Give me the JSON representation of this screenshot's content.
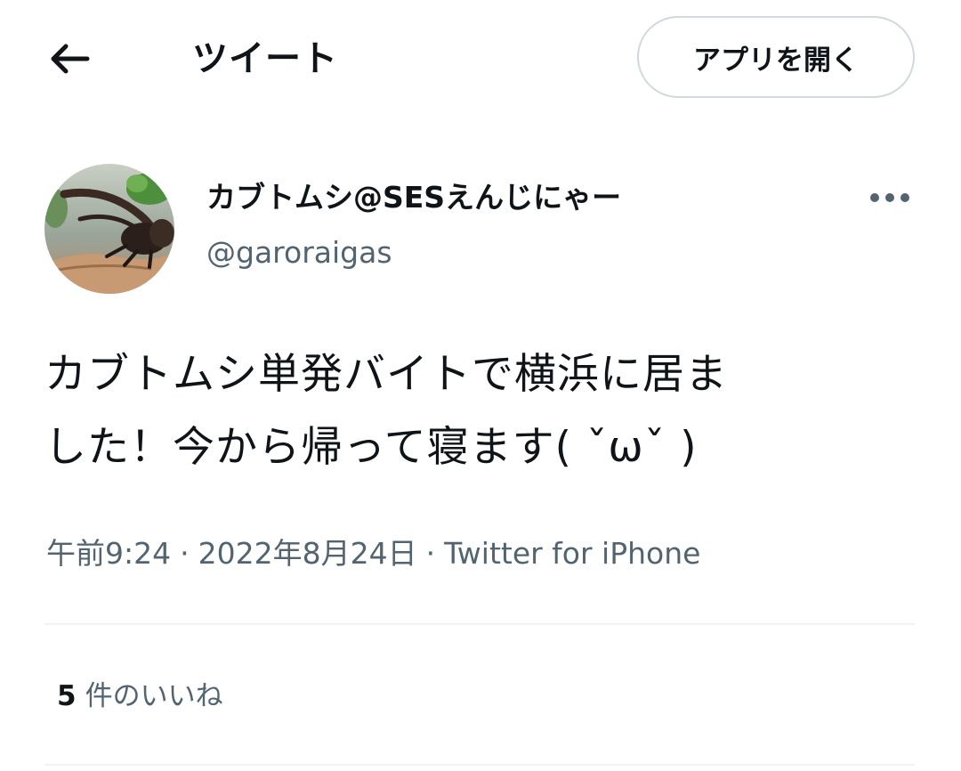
{
  "header": {
    "back_icon": "arrow-left-icon",
    "title": "ツイート",
    "open_app_label": "アプリを開く"
  },
  "author": {
    "display_name": "カブトムシ@SESえんじにゃー",
    "handle": "@garoraigas",
    "avatar_icon": "beetle-avatar",
    "more_icon": "more-horizontal-icon"
  },
  "tweet": {
    "lines": [
      "カブトムシ単発バイトで横浜に居ま",
      "した！今から帰って寝ます( ˇωˇ )"
    ],
    "time": "午前9:24",
    "date": "2022年8月24日",
    "source": "Twitter for iPhone",
    "separator": "·"
  },
  "stats": {
    "likes_count": "5",
    "likes_label": "件のいいね"
  },
  "colors": {
    "text_primary": "#0f1419",
    "text_secondary": "#536471",
    "border": "#cfd9de",
    "divider": "#eff3f4"
  }
}
